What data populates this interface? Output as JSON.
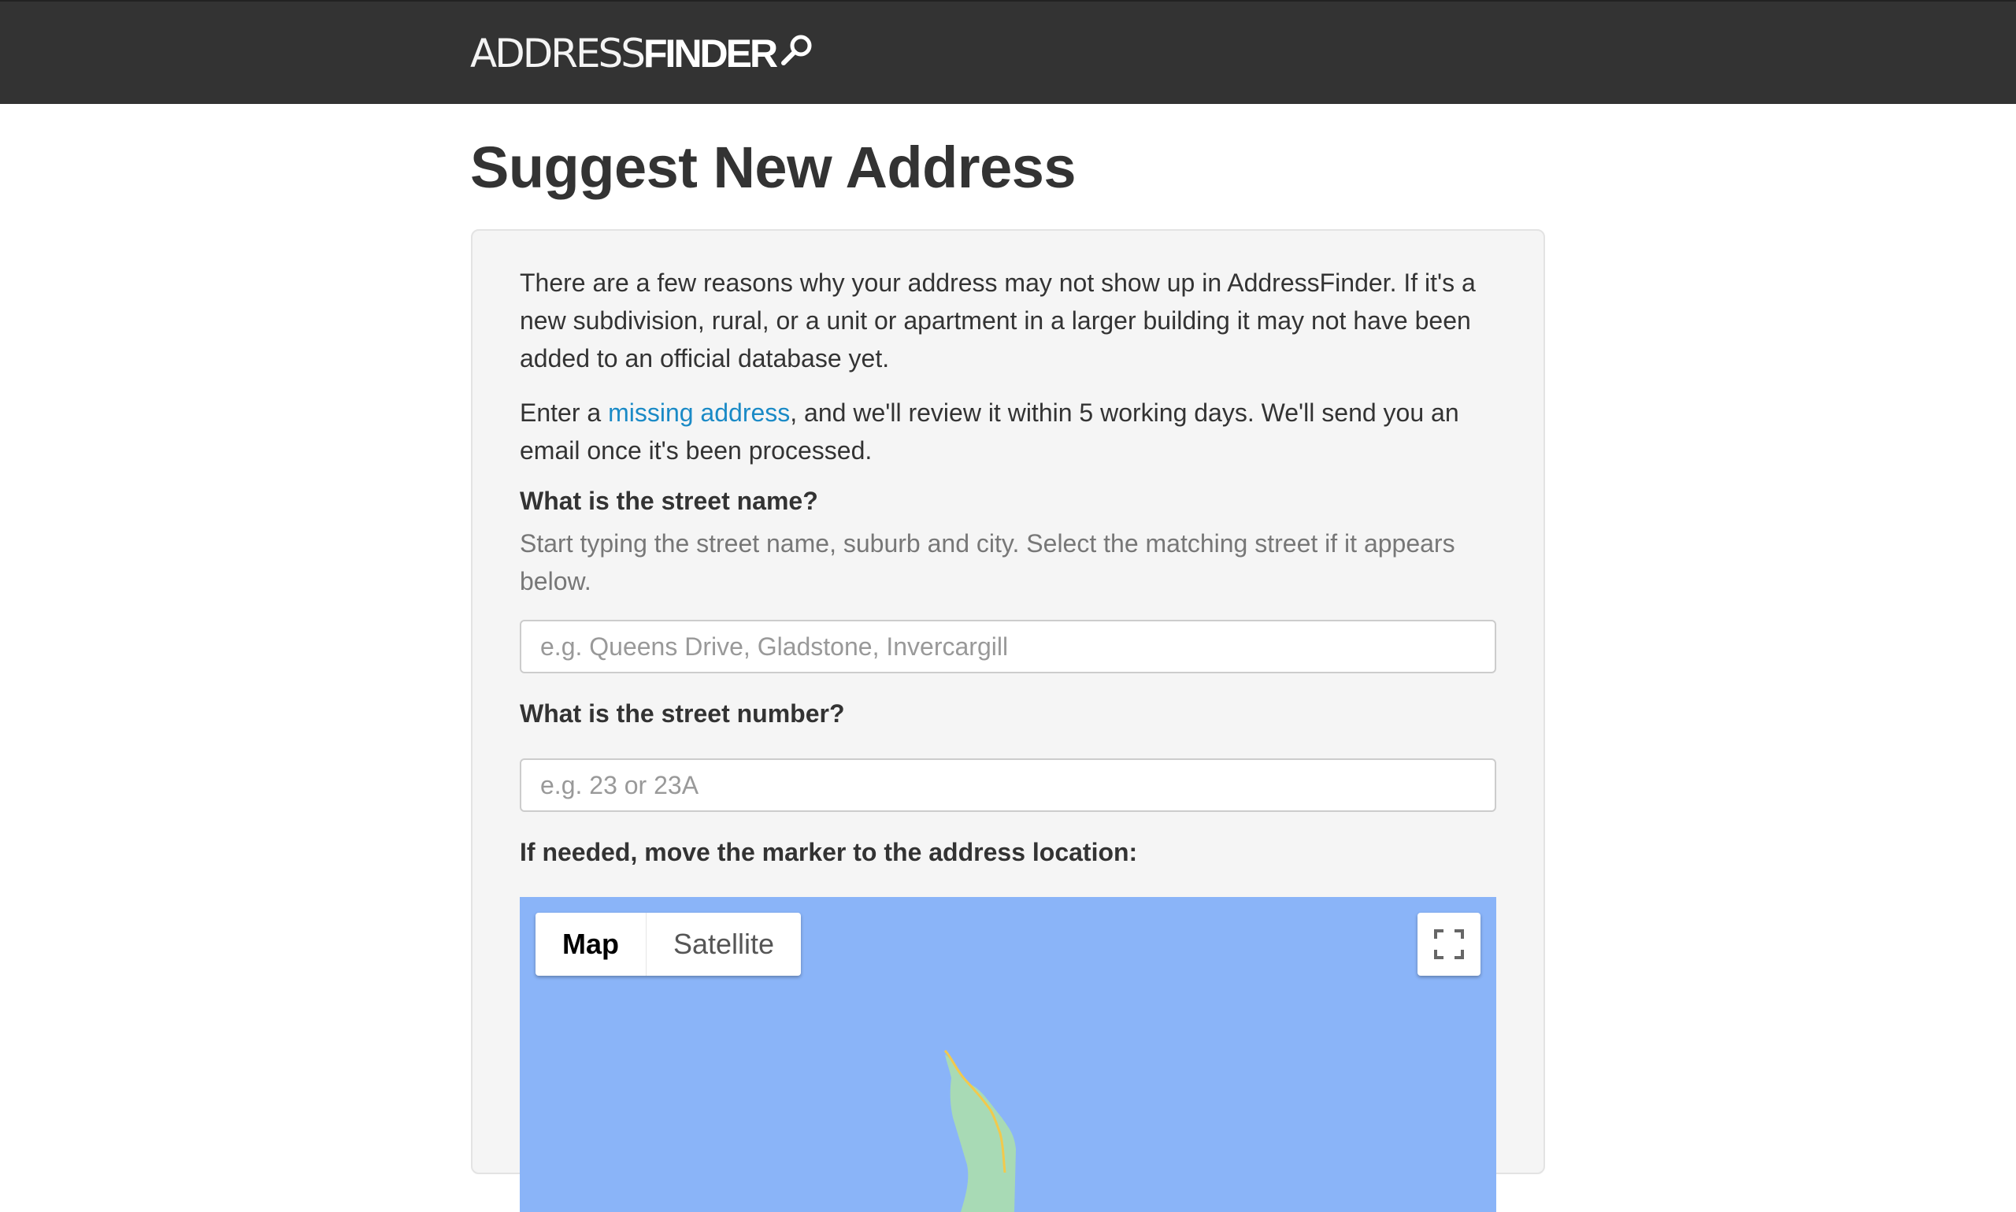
{
  "header": {
    "logo_light": "ADDRESS",
    "logo_bold": "FINDER"
  },
  "page": {
    "title": "Suggest New Address"
  },
  "intro": {
    "paragraph1": "There are a few reasons why your address may not show up in AddressFinder. If it's a new subdivision, rural, or a unit or apartment in a larger building it may not have been added to an official database yet.",
    "p2_before": "Enter a ",
    "p2_link": "missing address",
    "p2_after": ", and we'll review it within 5 working days. We'll send you an email once it's been processed."
  },
  "form": {
    "street_name_label": "What is the street name?",
    "street_name_help": "Start typing the street name, suburb and city. Select the matching street if it appears below.",
    "street_name_placeholder": "e.g. Queens Drive, Gladstone, Invercargill",
    "street_name_value": "",
    "street_number_label": "What is the street number?",
    "street_number_placeholder": "e.g. 23 or 23A",
    "street_number_value": "",
    "map_label": "If needed, move the marker to the address location:"
  },
  "map": {
    "type_map": "Map",
    "type_satellite": "Satellite",
    "selected_type": "Map",
    "water_color": "#8ab4f8",
    "land_color": "#a8dab5",
    "road_color": "#f2c94c",
    "fullscreen_icon": "fullscreen-icon"
  },
  "colors": {
    "header_bg": "#333333",
    "link": "#1a8ac6",
    "panel_bg": "#f5f5f5"
  }
}
